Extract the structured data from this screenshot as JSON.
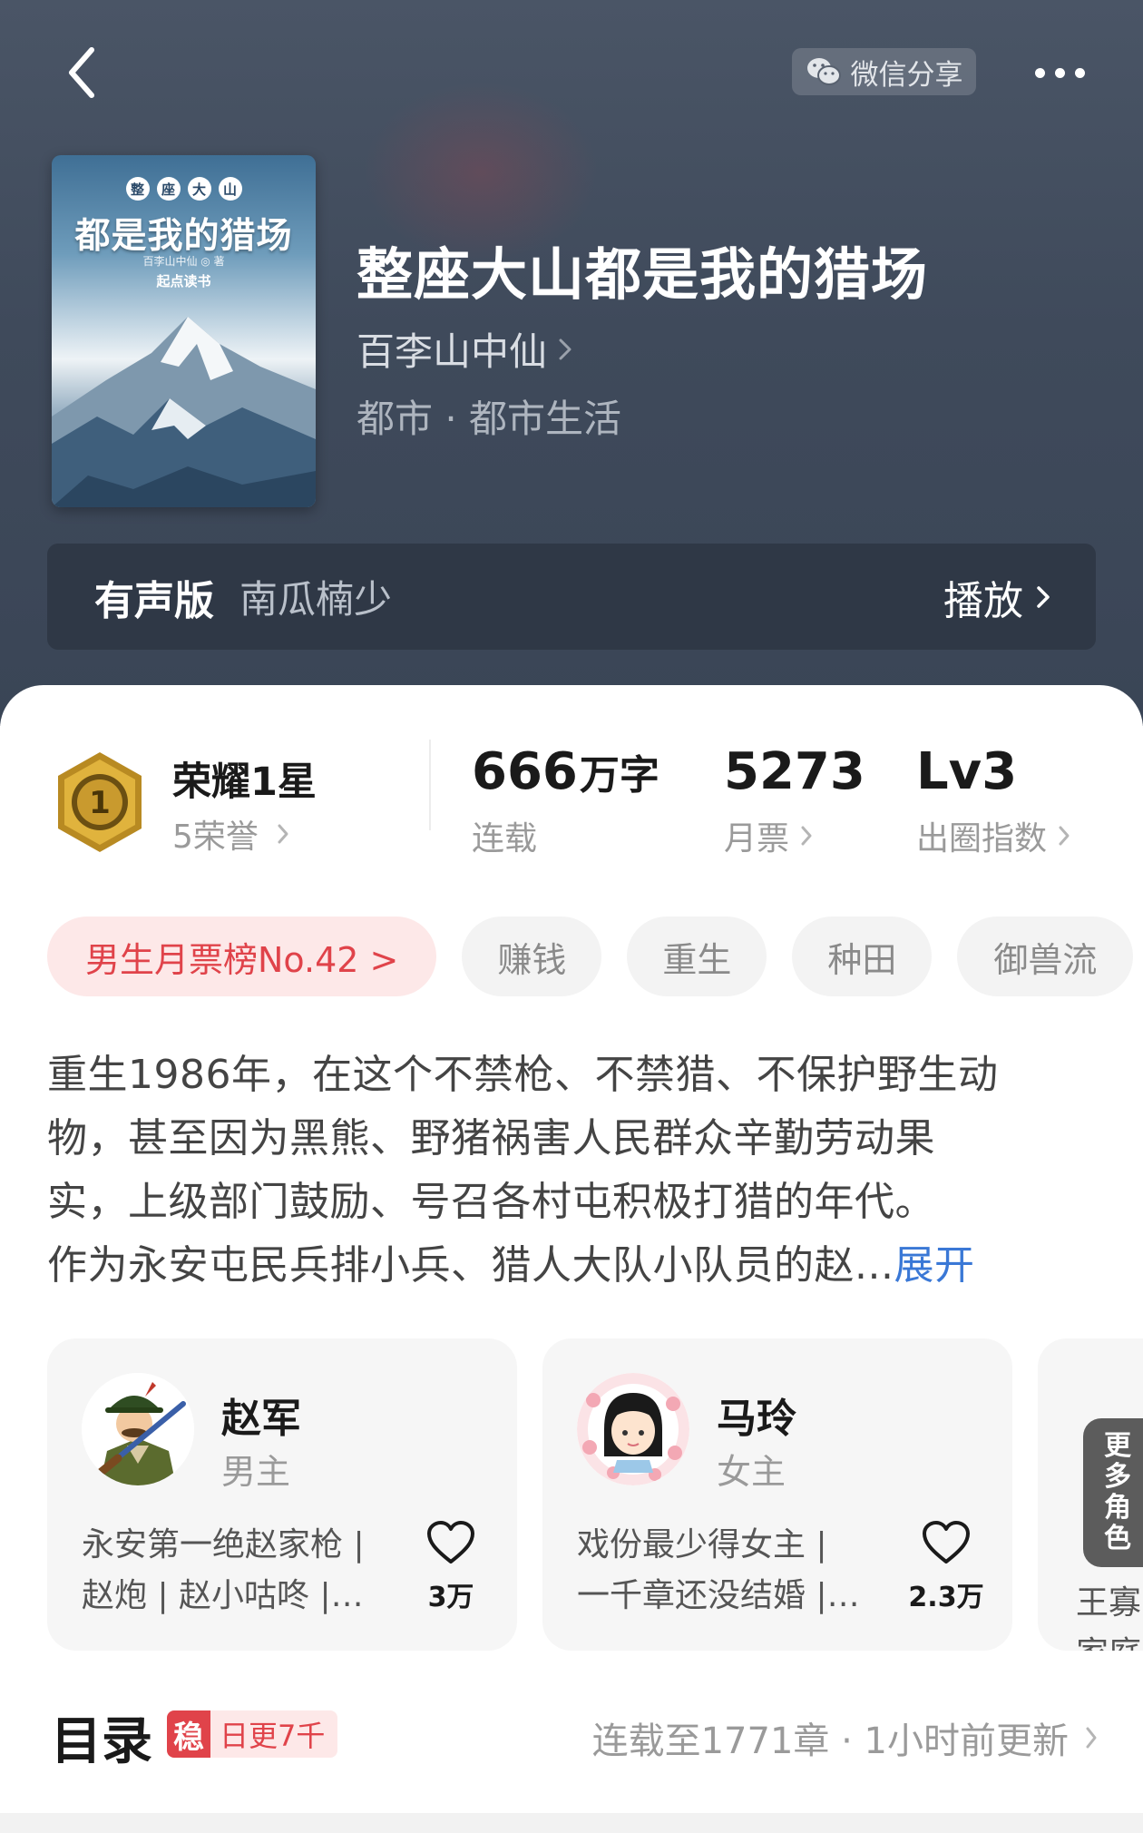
{
  "header": {
    "share_label": "微信分享",
    "icons": {
      "back": "back-arrow-icon",
      "share": "wechat-icon",
      "more": "more-dots-icon"
    }
  },
  "book": {
    "title": "整座大山都是我的猎场",
    "author": "百李山中仙",
    "genre": "都市 · 都市生活",
    "cover": {
      "badges": [
        "整",
        "座",
        "大",
        "山"
      ],
      "title": "都是我的猎场",
      "author_line": "百李山中仙 ◎ 著",
      "publisher": "起点读书"
    }
  },
  "audio": {
    "label": "有声版",
    "narrator": "南瓜楠少",
    "play_label": "播放"
  },
  "stats": {
    "honor_title": "荣耀1星",
    "honor_sub": "5荣誉",
    "honor_level": "1",
    "words_value": "666",
    "words_unit": "万字",
    "words_label": "连载",
    "monthly_value": "5273",
    "monthly_label": "月票",
    "level_value": "Lv3",
    "level_label": "出圈指数"
  },
  "tags": {
    "rank": "男生月票榜No.42 >",
    "items": [
      "赚钱",
      "重生",
      "种田",
      "御兽流"
    ]
  },
  "description": {
    "lines": [
      "重生1986年，在这个不禁枪、不禁猎、不保护野生动",
      "物，甚至因为黑熊、野猪祸害人民群众辛勤劳动果",
      "实，上级部门鼓励、号召各村屯积极打猎的年代。",
      "作为永安屯民兵排小兵、猎人大队小队员的赵..."
    ],
    "expand": "展开"
  },
  "characters": [
    {
      "name": "赵军",
      "role": "男主",
      "desc_line1": "永安第一绝赵家枪 |",
      "desc_line2": "赵炮 | 赵小咕咚 |…",
      "likes": "3万"
    },
    {
      "name": "马玲",
      "role": "女主",
      "desc_line1": "戏份最少得女主 |",
      "desc_line2": "一千章还没结婚 |…",
      "likes": "2.3万"
    }
  ],
  "characters_peek": {
    "more_label": [
      "更",
      "多",
      "角",
      "色"
    ],
    "text1": "王寡",
    "text2": "家庭"
  },
  "toc": {
    "title": "目录",
    "stable_badge": "稳",
    "update_badge": "日更7千",
    "status": "连载至1771章 · 1小时前更新"
  },
  "colors": {
    "accent_red": "#e0434a",
    "link_blue": "#3a78d6",
    "header_bg": "#434e5f"
  }
}
